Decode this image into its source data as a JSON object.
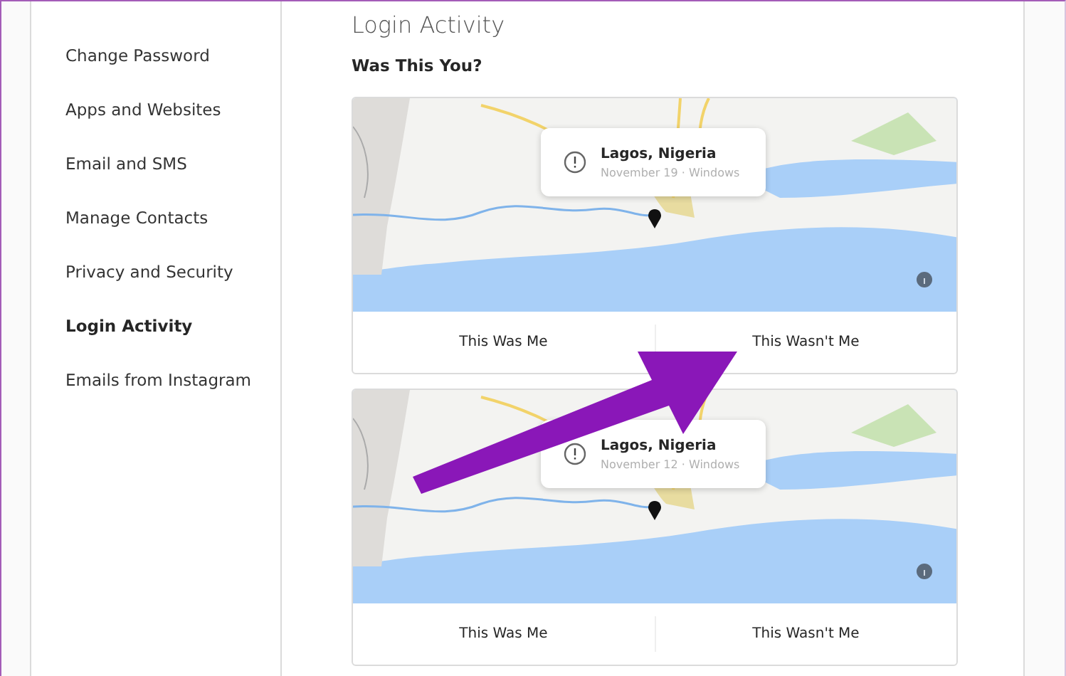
{
  "sidebar": {
    "items": [
      {
        "label": "Change Password",
        "selected": false
      },
      {
        "label": "Apps and Websites",
        "selected": false
      },
      {
        "label": "Email and SMS",
        "selected": false
      },
      {
        "label": "Manage Contacts",
        "selected": false
      },
      {
        "label": "Privacy and Security",
        "selected": false
      },
      {
        "label": "Login Activity",
        "selected": true
      },
      {
        "label": "Emails from Instagram",
        "selected": false
      }
    ]
  },
  "page": {
    "title": "Login Activity",
    "subtitle": "Was This You?"
  },
  "logins": [
    {
      "location": "Lagos, Nigeria",
      "details": "November 19 · Windows",
      "actions": [
        "This Was Me",
        "This Wasn't Me"
      ]
    },
    {
      "location": "Lagos, Nigeria",
      "details": "November 12 · Windows",
      "actions": [
        "This Was Me",
        "This Wasn't Me"
      ]
    }
  ]
}
